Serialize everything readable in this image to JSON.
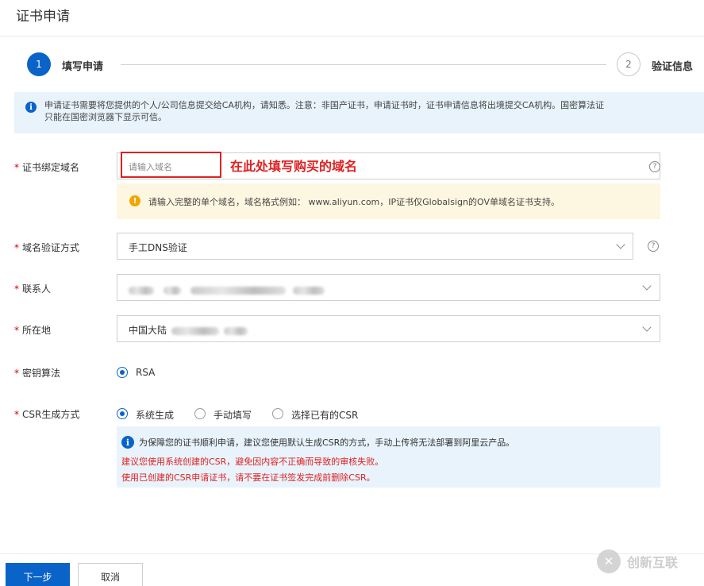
{
  "page": {
    "title": "证书申请"
  },
  "steps": [
    {
      "number": "1",
      "label": "填写申请",
      "active": true
    },
    {
      "number": "2",
      "label": "验证信息",
      "active": false
    }
  ],
  "notice": {
    "icon": "info-icon",
    "line1": "申请证书需要将您提供的个人/公司信息提交给CA机构，请知悉。注意：非国产证书，申请证书时，证书申请信息将出境提交CA机构。国密算法证",
    "line2": "只能在国密浏览器下显示可信。"
  },
  "form": {
    "domain": {
      "required_mark": "*",
      "label": "证书绑定域名",
      "placeholder": "请输入域名",
      "annotation": "在此处填写购买的域名",
      "help": "?",
      "warning": "请输入完整的单个域名，域名格式例如： www.aliyun.com，IP证书仅Globalsign的OV单域名证书支持。"
    },
    "verify_method": {
      "required_mark": "*",
      "label": "域名验证方式",
      "value": "手工DNS验证",
      "help": "?"
    },
    "contact": {
      "required_mark": "*",
      "label": "联系人",
      "value": ""
    },
    "location": {
      "required_mark": "*",
      "label": "所在地",
      "value": "中国大陆"
    },
    "key_algorithm": {
      "required_mark": "*",
      "label": "密钥算法",
      "option": "RSA"
    },
    "csr_method": {
      "required_mark": "*",
      "label": "CSR生成方式",
      "options": [
        "系统生成",
        "手动填写",
        "选择已有的CSR"
      ],
      "selected": "系统生成",
      "info_line1": "为保障您的证书顺利申请，建议您使用默认生成CSR的方式，手动上传将无法部署到阿里云产品。",
      "info_line2": "建议您使用系统创建的CSR，避免因内容不正确而导致的审核失败。",
      "info_line3": "使用已创建的CSR申请证书，请不要在证书签发完成前删除CSR。"
    }
  },
  "footer": {
    "next_label": "下一步",
    "cancel_label": "取消"
  },
  "watermark": {
    "text": "创新互联"
  },
  "colors": {
    "primary": "#0a63c9",
    "annotation": "#e02020",
    "warning_bg": "#fdf6e0",
    "info_bg": "#e8f3fc"
  }
}
